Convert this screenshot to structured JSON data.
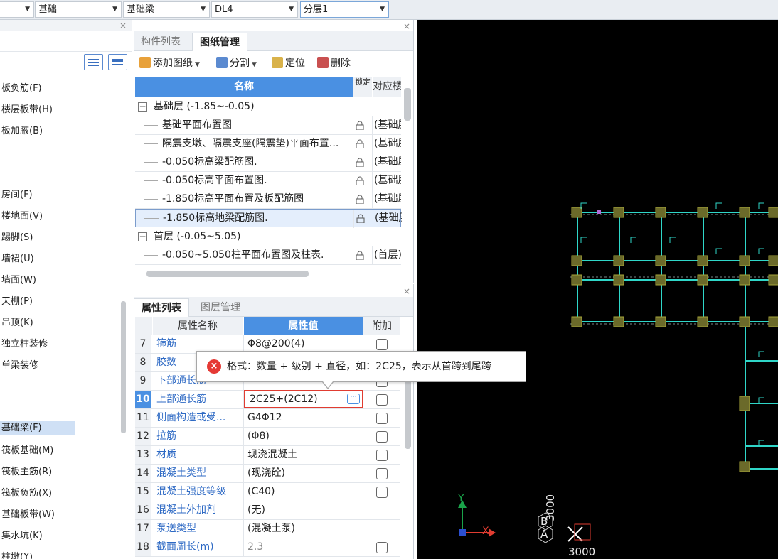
{
  "toolbar_top": {
    "dropdowns": [
      {
        "label": "",
        "active": false
      },
      {
        "label": "基础",
        "active": false
      },
      {
        "label": "基础梁",
        "active": false
      },
      {
        "label": "DL4",
        "active": false
      },
      {
        "label": "分层1",
        "active": true
      }
    ]
  },
  "component_types": {
    "items": [
      {
        "label": "板负筋(F)",
        "selected": false
      },
      {
        "label": "楼层板带(H)",
        "selected": false
      },
      {
        "label": "板加腋(B)",
        "selected": false
      },
      {
        "label": "房间(F)",
        "selected": false
      },
      {
        "label": "楼地面(V)",
        "selected": false
      },
      {
        "label": "踢脚(S)",
        "selected": false
      },
      {
        "label": "墙裙(U)",
        "selected": false
      },
      {
        "label": "墙面(W)",
        "selected": false
      },
      {
        "label": "天棚(P)",
        "selected": false
      },
      {
        "label": "吊顶(K)",
        "selected": false
      },
      {
        "label": "独立柱装修",
        "selected": false
      },
      {
        "label": "单梁装修",
        "selected": false
      },
      {
        "label": "基础梁(F)",
        "selected": true
      },
      {
        "label": "筏板基础(M)",
        "selected": false
      },
      {
        "label": "筏板主筋(R)",
        "selected": false
      },
      {
        "label": "筏板负筋(X)",
        "selected": false
      },
      {
        "label": "基础板带(W)",
        "selected": false
      },
      {
        "label": "集水坑(K)",
        "selected": false
      },
      {
        "label": "柱墩(Y)",
        "selected": false
      }
    ]
  },
  "drawing_panel": {
    "tabs": [
      "构件列表",
      "图纸管理"
    ],
    "active_tab": 1,
    "actions": {
      "add": "添加图纸",
      "split": "分割",
      "locate": "定位",
      "delete": "删除"
    },
    "columns": {
      "name": "名称",
      "lock": "锁定",
      "floor": "对应楼层"
    },
    "groups": [
      {
        "label": "基础层 (-1.85~-0.05)",
        "rows": [
          {
            "name": "基础平面布置图",
            "floor": "(基础层)"
          },
          {
            "name": "隔震支墩、隔震支座(隔震垫)平面布置...",
            "floor": "(基础层)"
          },
          {
            "name": "-0.050标高梁配筋图.",
            "floor": "(基础层)"
          },
          {
            "name": "-0.050标高平面布置图.",
            "floor": "(基础层)"
          },
          {
            "name": "-1.850标高平面布置及板配筋图",
            "floor": "(基础层)"
          },
          {
            "name": "-1.850标高地梁配筋图.",
            "floor": "(基础层)",
            "selected": true
          }
        ]
      },
      {
        "label": "首层 (-0.05~5.05)",
        "rows": [
          {
            "name": "-0.050~5.050柱平面布置图及柱表.",
            "floor": "(首层)"
          }
        ]
      }
    ]
  },
  "props_panel": {
    "tabs": [
      "属性列表",
      "图层管理"
    ],
    "active_tab": 0,
    "columns": {
      "name": "属性名称",
      "value": "属性值",
      "extra": "附加"
    },
    "rows": [
      {
        "no": "7",
        "name": "箍筋",
        "value": "Φ8@200(4)",
        "check": true
      },
      {
        "no": "8",
        "name": "胶数",
        "value": "",
        "check": true
      },
      {
        "no": "9",
        "name": "下部通长筋",
        "value": "",
        "check": true
      },
      {
        "no": "10",
        "name": "上部通长筋",
        "value": "2C25+(2C12)",
        "check": true,
        "editing": true
      },
      {
        "no": "11",
        "name": "侧面构造或受...",
        "value": "G4Φ12",
        "check": true
      },
      {
        "no": "12",
        "name": "拉筋",
        "value": "(Φ8)",
        "check": true
      },
      {
        "no": "13",
        "name": "材质",
        "value": "现浇混凝土",
        "check": true
      },
      {
        "no": "14",
        "name": "混凝土类型",
        "value": "(现浇砼)",
        "check": true
      },
      {
        "no": "15",
        "name": "混凝土强度等级",
        "value": "(C40)",
        "check": true
      },
      {
        "no": "16",
        "name": "混凝土外加剂",
        "value": "(无)",
        "check": false
      },
      {
        "no": "17",
        "name": "泵送类型",
        "value": "(混凝土泵)",
        "check": false
      },
      {
        "no": "18",
        "name": "截面周长(m)",
        "value": "2.3",
        "check": true,
        "gray": true
      }
    ]
  },
  "tooltip": {
    "text": "格式：数量 + 级别 + 直径，如：2C25，表示从首跨到尾跨"
  },
  "cad_view": {
    "axis_x": "X",
    "axis_y": "Y",
    "label_b": "B",
    "label_a": "A",
    "dim_vertical": "3000",
    "dim_horizontal": "3000",
    "colors": {
      "background": "#000000",
      "beam": "#2fd6c8",
      "column": "#6b6a2a",
      "axis": "#1aa34a"
    }
  }
}
